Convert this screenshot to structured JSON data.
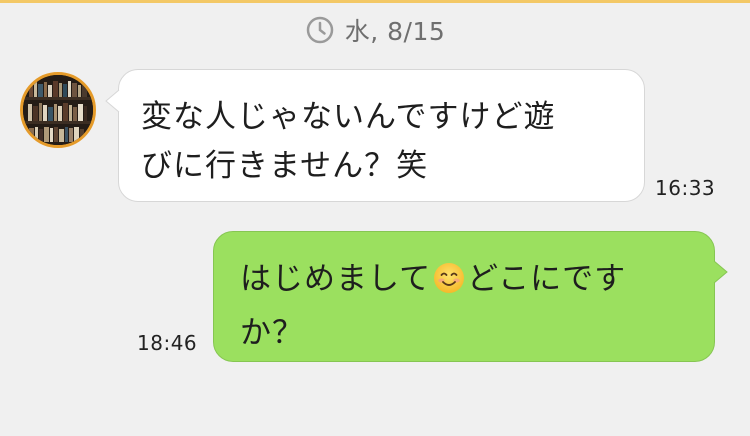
{
  "header": {
    "date_label": "水, 8/15",
    "icon": "clock-icon"
  },
  "messages": [
    {
      "direction": "incoming",
      "avatar_icon": "bookshelf-avatar",
      "text_line1": "変な人じゃないんですけど遊",
      "text_line2": "びに行きません？笑",
      "time": "16:33",
      "bubble_color": "#ffffff"
    },
    {
      "direction": "outgoing",
      "text_part1": "はじめまして",
      "emoji": "smiling-face-emoji",
      "text_part2": "どこにです",
      "text_line2": "か？",
      "time": "18:46",
      "bubble_color": "#9be05f"
    }
  ],
  "colors": {
    "background": "#f0f0f0",
    "accent": "#e59b2a",
    "outgoing_bubble": "#9be05f",
    "incoming_bubble": "#ffffff"
  }
}
